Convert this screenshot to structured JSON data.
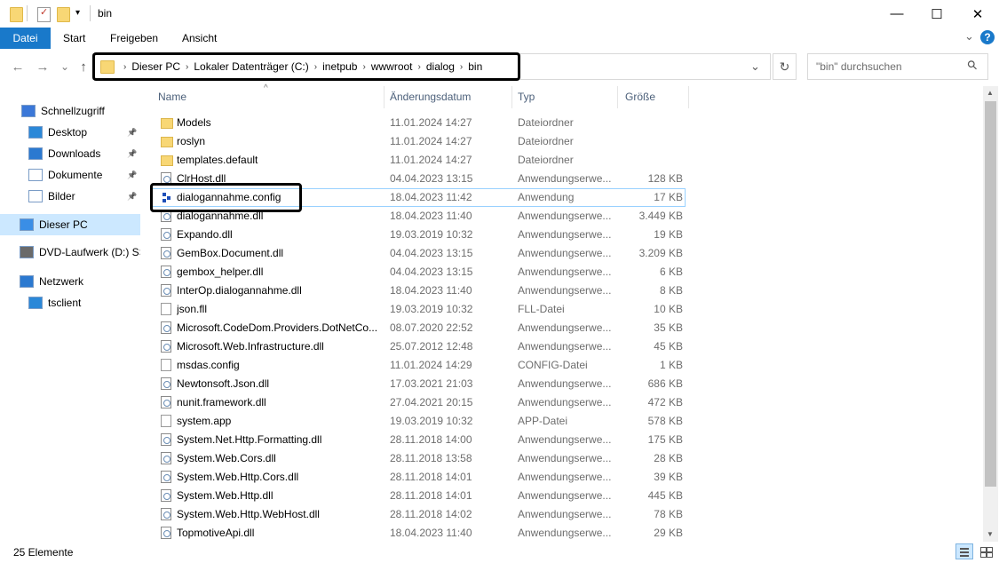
{
  "window": {
    "title": "bin",
    "minimize_glyph": "—",
    "maximize_glyph": "☐",
    "close_glyph": "✕",
    "dropdown_glyph": "▾"
  },
  "ribbon": {
    "tabs": [
      "Datei",
      "Start",
      "Freigeben",
      "Ansicht"
    ],
    "expand_glyph": "⌄",
    "help_glyph": "?"
  },
  "nav": {
    "back_glyph": "←",
    "forward_glyph": "→",
    "recent_glyph": "⌄",
    "up_glyph": "↑",
    "refresh_glyph": "↻",
    "dropdown_glyph": "⌄"
  },
  "breadcrumb": {
    "separator": "›",
    "items": [
      "Dieser PC",
      "Lokaler Datenträger (C:)",
      "inetpub",
      "wwwroot",
      "dialog",
      "bin"
    ]
  },
  "search": {
    "placeholder": "\"bin\" durchsuchen",
    "icon_glyph": "⚲"
  },
  "sidebar": {
    "items": [
      {
        "label": "Schnellzugriff",
        "icon": "star-icon",
        "pinned": false
      },
      {
        "label": "Desktop",
        "icon": "desktop-icon",
        "pinned": true
      },
      {
        "label": "Downloads",
        "icon": "download-icon",
        "pinned": true
      },
      {
        "label": "Dokumente",
        "icon": "documents-icon",
        "pinned": true
      },
      {
        "label": "Bilder",
        "icon": "pictures-icon",
        "pinned": true
      },
      {
        "label": "Dieser PC",
        "icon": "pc-icon",
        "pinned": false,
        "selected": true
      },
      {
        "label": "DVD-Laufwerk (D:) SS",
        "icon": "dvd-icon",
        "pinned": false
      },
      {
        "label": "Netzwerk",
        "icon": "network-icon",
        "pinned": false
      },
      {
        "label": "tsclient",
        "icon": "monitor-icon",
        "pinned": false
      }
    ],
    "pin_glyph": "📌"
  },
  "columns": [
    "Name",
    "Änderungsdatum",
    "Typ",
    "Größe"
  ],
  "sort_indicator": "^",
  "files": [
    {
      "name": "Models",
      "date": "11.01.2024 14:27",
      "type": "Dateiordner",
      "size": "",
      "icon": "folder"
    },
    {
      "name": "roslyn",
      "date": "11.01.2024 14:27",
      "type": "Dateiordner",
      "size": "",
      "icon": "folder"
    },
    {
      "name": "templates.default",
      "date": "11.01.2024 14:27",
      "type": "Dateiordner",
      "size": "",
      "icon": "folder"
    },
    {
      "name": "ClrHost.dll",
      "date": "04.04.2023 13:15",
      "type": "Anwendungserwe...",
      "size": "128 KB",
      "icon": "dll"
    },
    {
      "name": "dialogannahme.config",
      "date": "18.04.2023 11:42",
      "type": "Anwendung",
      "size": "17 KB",
      "icon": "app"
    },
    {
      "name": "dialogannahme.dll",
      "date": "18.04.2023 11:40",
      "type": "Anwendungserwe...",
      "size": "3.449 KB",
      "icon": "dll"
    },
    {
      "name": "Expando.dll",
      "date": "19.03.2019 10:32",
      "type": "Anwendungserwe...",
      "size": "19 KB",
      "icon": "dll"
    },
    {
      "name": "GemBox.Document.dll",
      "date": "04.04.2023 13:15",
      "type": "Anwendungserwe...",
      "size": "3.209 KB",
      "icon": "dll"
    },
    {
      "name": "gembox_helper.dll",
      "date": "04.04.2023 13:15",
      "type": "Anwendungserwe...",
      "size": "6 KB",
      "icon": "dll"
    },
    {
      "name": "InterOp.dialogannahme.dll",
      "date": "18.04.2023 11:40",
      "type": "Anwendungserwe...",
      "size": "8 KB",
      "icon": "dll"
    },
    {
      "name": "json.fll",
      "date": "19.03.2019 10:32",
      "type": "FLL-Datei",
      "size": "10 KB",
      "icon": "file"
    },
    {
      "name": "Microsoft.CodeDom.Providers.DotNetCo...",
      "date": "08.07.2020 22:52",
      "type": "Anwendungserwe...",
      "size": "35 KB",
      "icon": "dll"
    },
    {
      "name": "Microsoft.Web.Infrastructure.dll",
      "date": "25.07.2012 12:48",
      "type": "Anwendungserwe...",
      "size": "45 KB",
      "icon": "dll"
    },
    {
      "name": "msdas.config",
      "date": "11.01.2024 14:29",
      "type": "CONFIG-Datei",
      "size": "1 KB",
      "icon": "file"
    },
    {
      "name": "Newtonsoft.Json.dll",
      "date": "17.03.2021 21:03",
      "type": "Anwendungserwe...",
      "size": "686 KB",
      "icon": "dll"
    },
    {
      "name": "nunit.framework.dll",
      "date": "27.04.2021 20:15",
      "type": "Anwendungserwe...",
      "size": "472 KB",
      "icon": "dll"
    },
    {
      "name": "system.app",
      "date": "19.03.2019 10:32",
      "type": "APP-Datei",
      "size": "578 KB",
      "icon": "file"
    },
    {
      "name": "System.Net.Http.Formatting.dll",
      "date": "28.11.2018 14:00",
      "type": "Anwendungserwe...",
      "size": "175 KB",
      "icon": "dll"
    },
    {
      "name": "System.Web.Cors.dll",
      "date": "28.11.2018 13:58",
      "type": "Anwendungserwe...",
      "size": "28 KB",
      "icon": "dll"
    },
    {
      "name": "System.Web.Http.Cors.dll",
      "date": "28.11.2018 14:01",
      "type": "Anwendungserwe...",
      "size": "39 KB",
      "icon": "dll"
    },
    {
      "name": "System.Web.Http.dll",
      "date": "28.11.2018 14:01",
      "type": "Anwendungserwe...",
      "size": "445 KB",
      "icon": "dll"
    },
    {
      "name": "System.Web.Http.WebHost.dll",
      "date": "28.11.2018 14:02",
      "type": "Anwendungserwe...",
      "size": "78 KB",
      "icon": "dll"
    },
    {
      "name": "TopmotiveApi.dll",
      "date": "18.04.2023 11:40",
      "type": "Anwendungserwe...",
      "size": "29 KB",
      "icon": "dll"
    }
  ],
  "status": {
    "count": "25 Elemente"
  },
  "colors": {
    "accent": "#1979ca",
    "selected": "#cce8ff",
    "hover_border": "#99d1ff"
  }
}
